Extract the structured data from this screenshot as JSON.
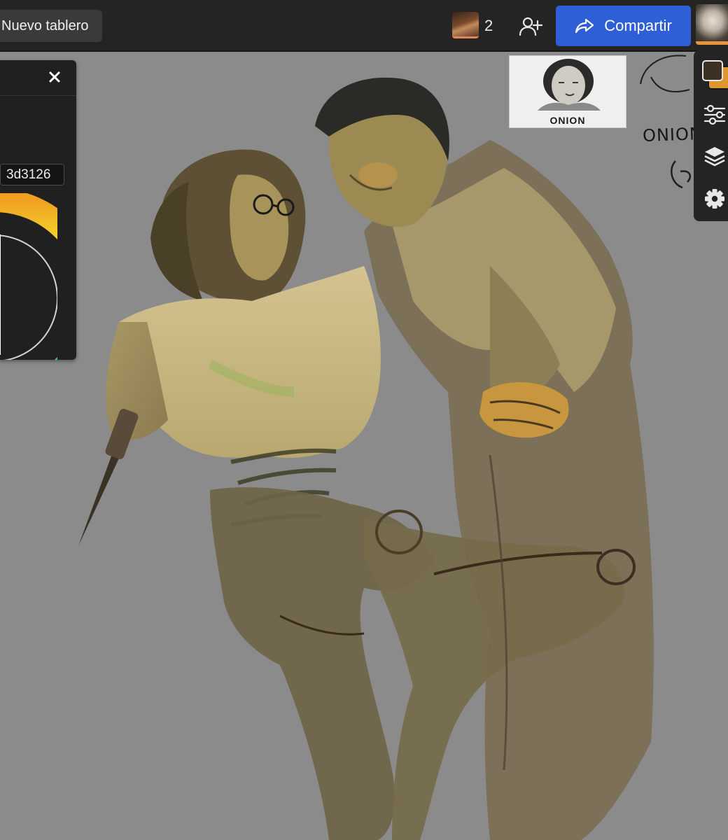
{
  "header": {
    "new_board_label": "Nuevo tablero",
    "collaborator_count": "2",
    "share_label": "Compartir"
  },
  "color_panel": {
    "hex_value": "3d3126"
  },
  "reference": {
    "caption": "ONION",
    "note": "ONION C"
  },
  "colors": {
    "current_color": "#3d3126",
    "secondary_color": "#e0962e",
    "share_button": "#2f5fd6",
    "canvas_background": "#8b8b8b"
  },
  "icons": [
    "close-icon",
    "add-user-icon",
    "share-icon",
    "sliders-icon",
    "layers-icon",
    "gear-icon"
  ]
}
